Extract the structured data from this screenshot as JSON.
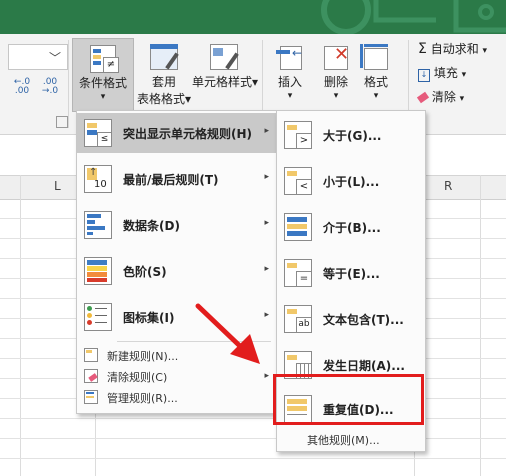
{
  "ribbon": {
    "conditional_format": "条件格式",
    "conditional_format_chevron": "▾",
    "table_format_1": "套用",
    "table_format_2": "表格格式",
    "cell_styles": "单元格样式",
    "insert": "插入",
    "delete": "删除",
    "format": "格式",
    "autosum": "自动求和",
    "fill": "填充",
    "clear": "清除",
    "decimal_increase": ".0\n.00",
    "decimal_decrease": ".00\n.0",
    "sum_glyph": "Σ"
  },
  "columns": [
    "L",
    "R"
  ],
  "main_menu": {
    "items": [
      {
        "label": "突出显示单元格规则(H)",
        "arrow": "▸"
      },
      {
        "label": "最前/最后规则(T)",
        "arrow": "▸",
        "icon_text": "10"
      },
      {
        "label": "数据条(D)",
        "arrow": "▸"
      },
      {
        "label": "色阶(S)",
        "arrow": "▸"
      },
      {
        "label": "图标集(I)",
        "arrow": "▸"
      }
    ],
    "small_items": [
      {
        "label": "新建规则(N)..."
      },
      {
        "label": "清除规则(C)",
        "arrow": "▸"
      },
      {
        "label": "管理规则(R)..."
      }
    ]
  },
  "sub_menu": {
    "items": [
      {
        "label": "大于(G)...",
        "icon_text": ">"
      },
      {
        "label": "小于(L)...",
        "icon_text": "<"
      },
      {
        "label": "介于(B)..."
      },
      {
        "label": "等于(E)...",
        "icon_text": "="
      },
      {
        "label": "文本包含(T)...",
        "icon_text": "ab"
      },
      {
        "label": "发生日期(A)..."
      },
      {
        "label": "重复值(D)..."
      }
    ],
    "other_rules": "其他规则(M)..."
  },
  "colors": {
    "ribbon_band": "#2b7a48",
    "highlight": "#e21d1d",
    "arrow": "#e21d1d",
    "menu_hover": "#c9c9c9"
  }
}
